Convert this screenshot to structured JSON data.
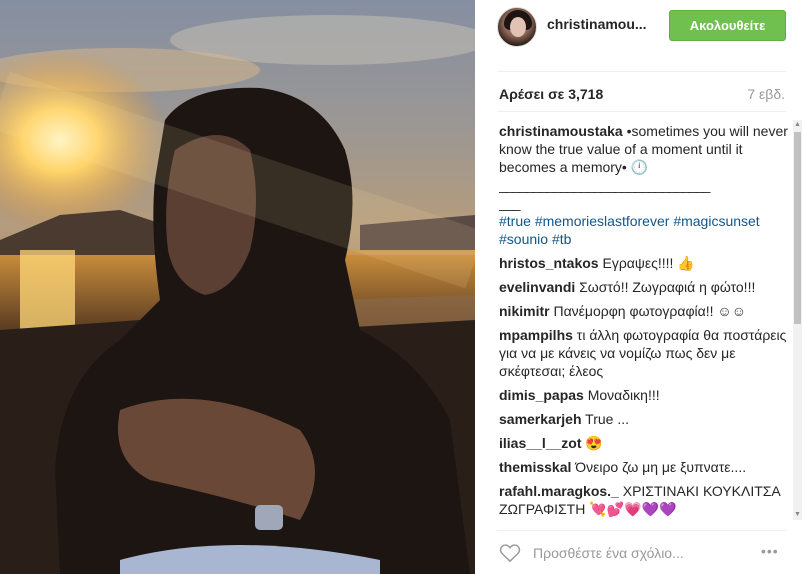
{
  "header": {
    "username": "christinamou...",
    "follow_label": "Ακολουθείτε"
  },
  "post": {
    "likes_text": "Αρέσει σε 3,718",
    "time_text": "7 εβδ."
  },
  "caption": {
    "username": "christinamoustaka",
    "text": "•sometimes you will never know the true value of a moment until it becomes a memory• 🕛",
    "separator": "_______________________________",
    "separator_tail": "___",
    "hashtags": [
      "#true",
      "#memorieslastforever",
      "#magicsunset",
      "#sounio",
      "#tb"
    ]
  },
  "comments": [
    {
      "user": "hristos_ntakos",
      "text": "Εγραψες!!!! 👍"
    },
    {
      "user": "evelinvandi",
      "text": "Σωστό!! Ζωγραφιά η φώτο!!!"
    },
    {
      "user": "nikimitr",
      "text": "Πανέμορφη φωτογραφία!! ☺☺"
    },
    {
      "user": "mpampilhs",
      "text": "τι άλλη φωτογραφία θα ποστάρεις για να με κάνεις να νομίζω πως δεν με σκέφτεσαι; έλεος"
    },
    {
      "user": "dimis_papas",
      "text": "Μοναδικη!!!"
    },
    {
      "user": "samerkarjeh",
      "text": "True ..."
    },
    {
      "user": "ilias__l__zot",
      "text": "😍"
    },
    {
      "user": "themisskal",
      "text": "Όνειρο ζω μη με ξυπνατε...."
    },
    {
      "user": "rafahl.maragkos._",
      "text": "ΧΡΙΣΤΙΝΑΚΙ ΚΟΥΚΛΙΤΣΑ ΖΩΓΡΑΦΙΣΤΗ 💘💕💗💜💜"
    }
  ],
  "footer": {
    "comment_placeholder": "Προσθέστε ένα σχόλιο...",
    "more_label": "•••"
  },
  "icons": {
    "heart": "heart-icon",
    "more": "more-options-icon"
  },
  "colors": {
    "follow_green": "#70c050",
    "hashtag_blue": "#125688",
    "muted": "#999999"
  }
}
